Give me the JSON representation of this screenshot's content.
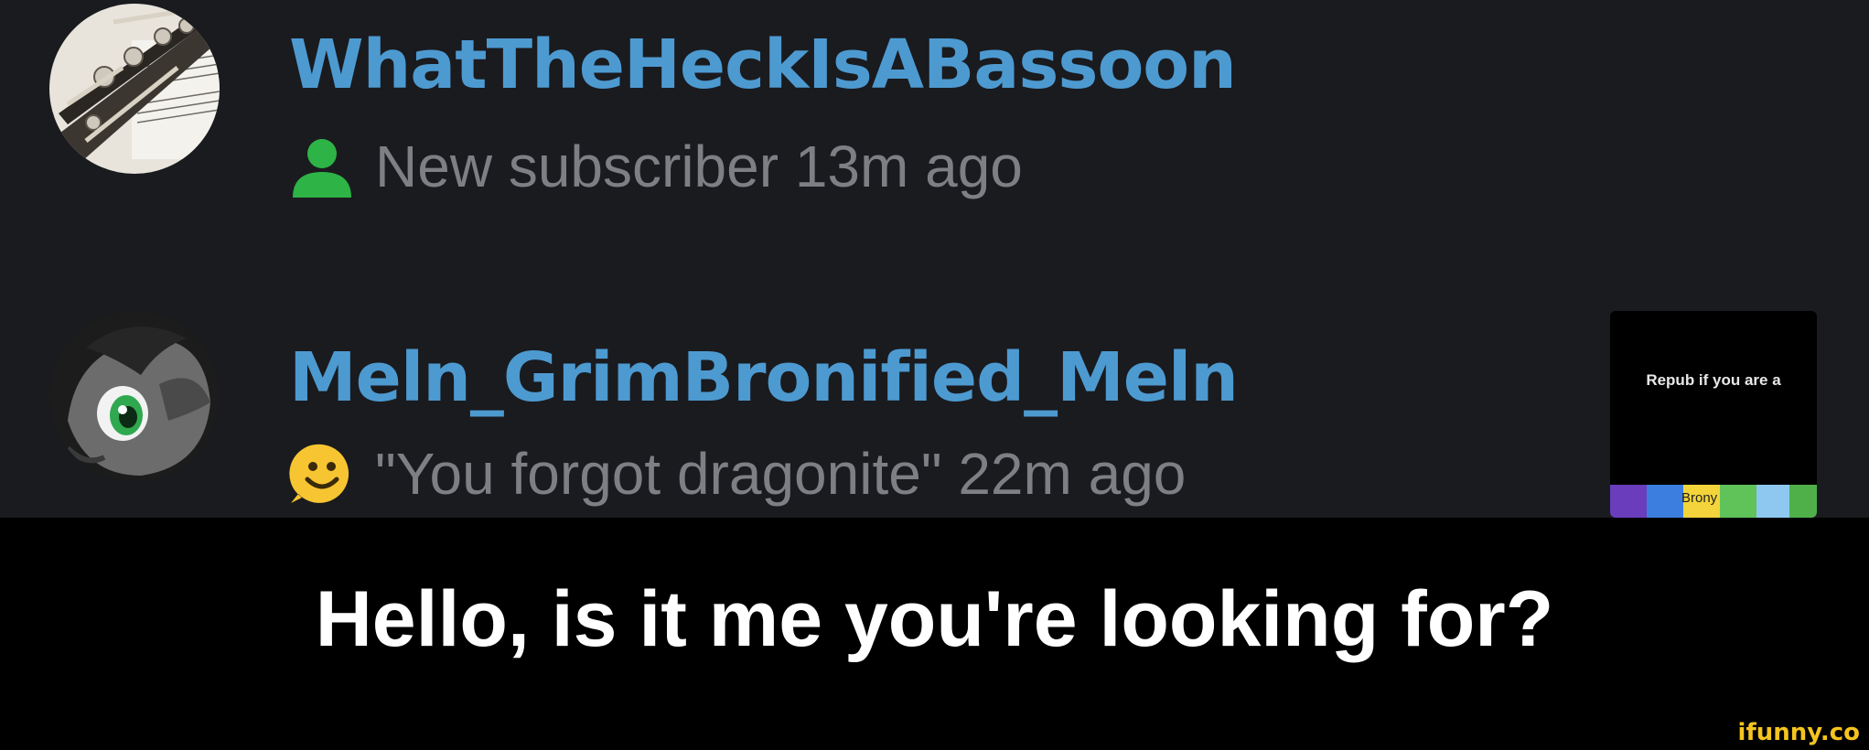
{
  "notifications": [
    {
      "username": "WhatTheHeckIsABassoon",
      "icon": "person-icon",
      "detail": "New subscriber 13m ago"
    },
    {
      "username": "Meln_GrimBronified_Meln",
      "icon": "smiley-icon",
      "detail": "\"You forgot dragonite\" 22m ago",
      "thumbnail": {
        "text": "Repub if you are a",
        "strip_text": "Brony"
      }
    }
  ],
  "caption": "Hello, is it me you're looking for?",
  "watermark": "ifunny.co",
  "colors": {
    "background": "#1a1b1f",
    "username": "#4d9ad1",
    "detail": "#7e7f84",
    "caption_bar": "#000000",
    "watermark": "#f4c41f"
  }
}
